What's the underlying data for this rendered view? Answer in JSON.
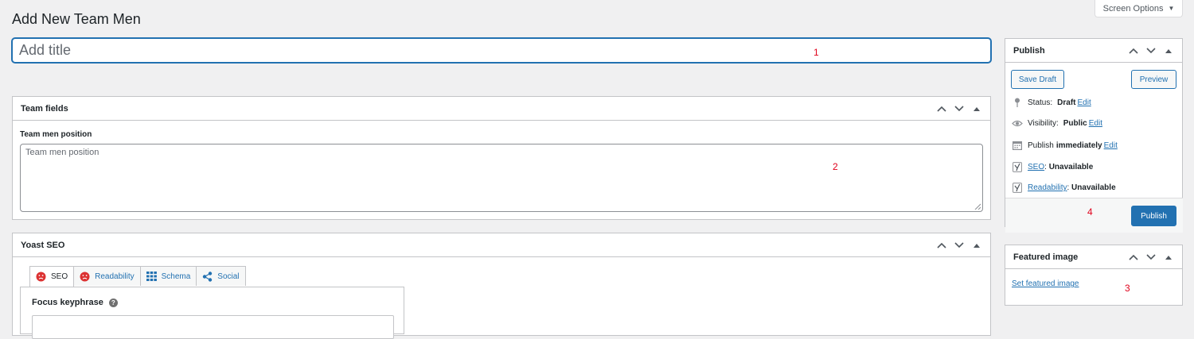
{
  "page": {
    "title": "Add New Team Men",
    "screen_options": "Screen Options"
  },
  "title_field": {
    "placeholder": "Add title",
    "value": ""
  },
  "annotations": {
    "one": "1",
    "two": "2",
    "three": "3",
    "four": "4"
  },
  "team_fields": {
    "title": "Team fields",
    "position_label": "Team men position",
    "position_placeholder": "Team men position"
  },
  "yoast": {
    "title": "Yoast SEO",
    "tabs": [
      {
        "label": "SEO",
        "icon": "sad-face-icon",
        "active": true
      },
      {
        "label": "Readability",
        "icon": "sad-face-icon",
        "active": false
      },
      {
        "label": "Schema",
        "icon": "grid-icon",
        "active": false
      },
      {
        "label": "Social",
        "icon": "share-icon",
        "active": false
      }
    ],
    "focus_label": "Focus keyphrase",
    "help": "?"
  },
  "publish": {
    "title": "Publish",
    "save_draft": "Save Draft",
    "preview": "Preview",
    "status_label": "Status:",
    "status_value": "Draft",
    "visibility_label": "Visibility:",
    "visibility_value": "Public",
    "publish_label": "Publish",
    "publish_value": "immediately",
    "edit": "Edit",
    "seo_link": "SEO",
    "seo_value": "Unavailable",
    "readability_link": "Readability",
    "readability_value": "Unavailable",
    "publish_button": "Publish"
  },
  "featured_image": {
    "title": "Featured image",
    "set_link": "Set featured image"
  },
  "colors": {
    "accent": "#2271b1",
    "error_face": "#dc3232",
    "annotation": "#e0001b",
    "background": "#f0f0f1"
  }
}
